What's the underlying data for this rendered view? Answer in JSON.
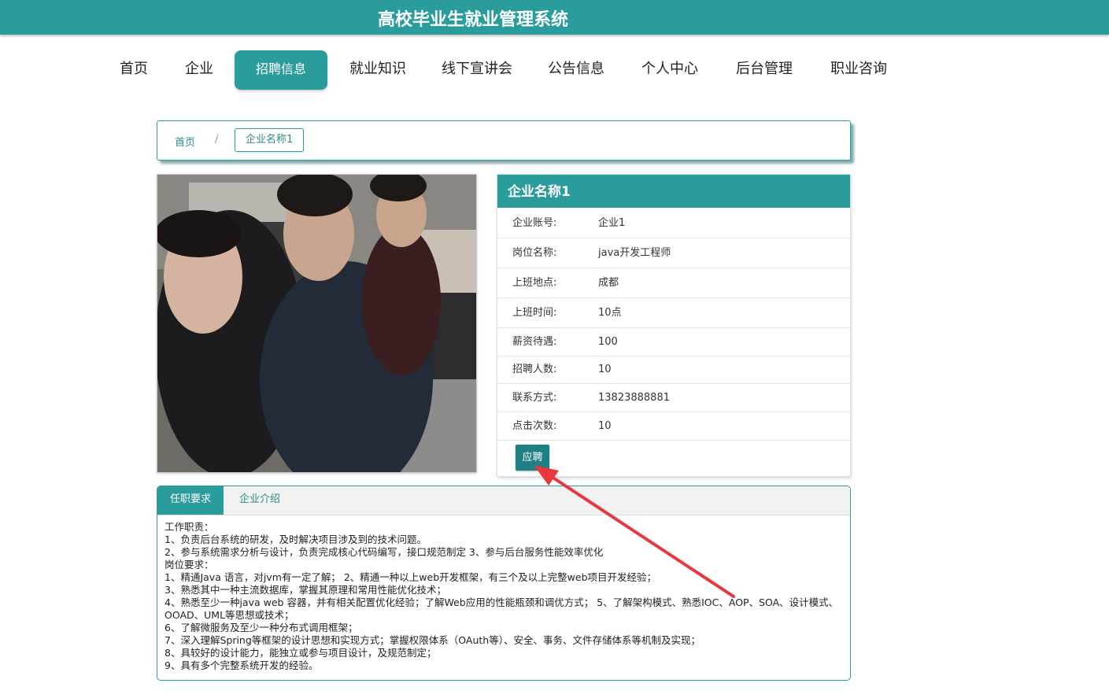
{
  "header": {
    "title": "高校毕业生就业管理系统"
  },
  "nav": [
    {
      "label": "首页",
      "active": false
    },
    {
      "label": "企业",
      "active": false
    },
    {
      "label": "招聘信息",
      "active": true
    },
    {
      "label": "就业知识",
      "active": false
    },
    {
      "label": "线下宣讲会",
      "active": false
    },
    {
      "label": "公告信息",
      "active": false
    },
    {
      "label": "个人中心",
      "active": false
    },
    {
      "label": "后台管理",
      "active": false
    },
    {
      "label": "职业咨询",
      "active": false
    }
  ],
  "breadcrumb": {
    "home": "首页",
    "separator": "/",
    "current": "企业名称1"
  },
  "detail": {
    "title": "企业名称1",
    "rows": [
      {
        "label": "企业账号:",
        "value": "企业1"
      },
      {
        "label": "岗位名称:",
        "value": "java开发工程师"
      },
      {
        "label": "上班地点:",
        "value": "成都"
      },
      {
        "label": "上班时间:",
        "value": "10点"
      },
      {
        "label": "薪资待遇:",
        "value": "100"
      },
      {
        "label": "招聘人数:",
        "value": "10"
      },
      {
        "label": "联系方式:",
        "value": "13823888881"
      },
      {
        "label": "点击次数:",
        "value": "10"
      }
    ],
    "apply_label": "应聘"
  },
  "tabs": {
    "active": "任职要求",
    "inactive": "企业介绍",
    "content": [
      "工作职责：",
      "1、负责后台系统的研发，及时解决项目涉及到的技术问题。",
      "2、参与系统需求分析与设计，负责完成核心代码编写，接口规范制定 3、参与后台服务性能效率优化",
      "岗位要求：",
      "1、精通Java 语言，对jvm有一定了解； 2、精通一种以上web开发框架，有三个及以上完整web项目开发经验；",
      "3、熟悉其中一种主流数据库，掌握其原理和常用性能优化技术；",
      "4、熟悉至少一种java web 容器，并有相关配置优化经验；了解Web应用的性能瓶颈和调优方式； 5、了解架构模式、熟悉IOC、AOP、SOA、设计模式、",
      "OOAD、UML等思想或技术；",
      "6、了解微服务及至少一种分布式调用框架；",
      "7、深入理解Spring等框架的设计思想和实现方式；掌握权限体系（OAuth等）、安全、事务、文件存储体系等机制及实现；",
      "8、具较好的设计能力，能独立或参与项目设计，及规范制定；",
      "9、具有多个完整系统开发的经验。"
    ]
  },
  "colors": {
    "primary": "#2a9c9c",
    "button": "#1e7f84",
    "annotation": "#e8383d"
  },
  "icons": {
    "annotation": "red-arrow-icon"
  }
}
